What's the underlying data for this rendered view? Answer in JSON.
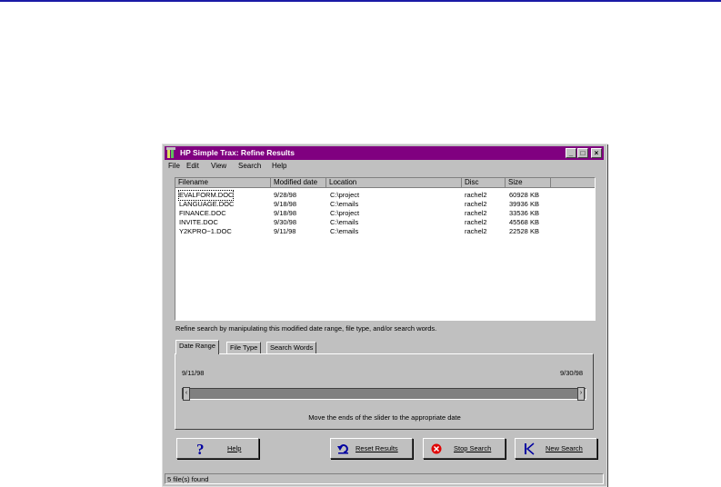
{
  "window": {
    "title": "HP Simple Trax: Refine Results",
    "controls": [
      "_",
      "□",
      "×"
    ]
  },
  "menu": [
    "File",
    "Edit",
    "View",
    "Search",
    "Help"
  ],
  "table": {
    "columns": [
      "Filename",
      "Modified date",
      "Location",
      "Disc",
      "Size"
    ],
    "rows": [
      [
        "EVALFORM.DOC",
        "9/28/98",
        "C:\\project",
        "rachel2",
        "60928 KB"
      ],
      [
        "LANGUAGE.DOC",
        "9/18/98",
        "C:\\emails",
        "rachel2",
        "39936 KB"
      ],
      [
        "FINANCE.DOC",
        "9/18/98",
        "C:\\project",
        "rachel2",
        "33536 KB"
      ],
      [
        "INVITE.DOC",
        "9/30/98",
        "C:\\emails",
        "rachel2",
        "45568 KB"
      ],
      [
        "Y2KPRO~1.DOC",
        "9/11/98",
        "C:\\emails",
        "rachel2",
        "22528 KB"
      ]
    ]
  },
  "hint": "Refine search by manipulating this modified date range, file type, and/or search words.",
  "tabs": [
    "Date Range",
    "File Type",
    "Search Words"
  ],
  "date_range": {
    "start": "9/11/98",
    "end": "9/30/98",
    "instruction": "Move the ends of the slider to the appropriate date"
  },
  "buttons": {
    "help": "Help",
    "reset": "Reset Results",
    "stop": "Stop Search",
    "new": "New Search"
  },
  "status": "5 file(s) found",
  "colors": {
    "titlebar": "#800080",
    "face": "#c0c0c0",
    "help_icon": "#0000a0",
    "stop_icon": "#e00000"
  },
  "icons": {
    "app": "app-icon",
    "help": "question-mark-icon",
    "reset": "reset-arrow-icon",
    "stop": "stop-icon",
    "new": "rewind-icon"
  }
}
